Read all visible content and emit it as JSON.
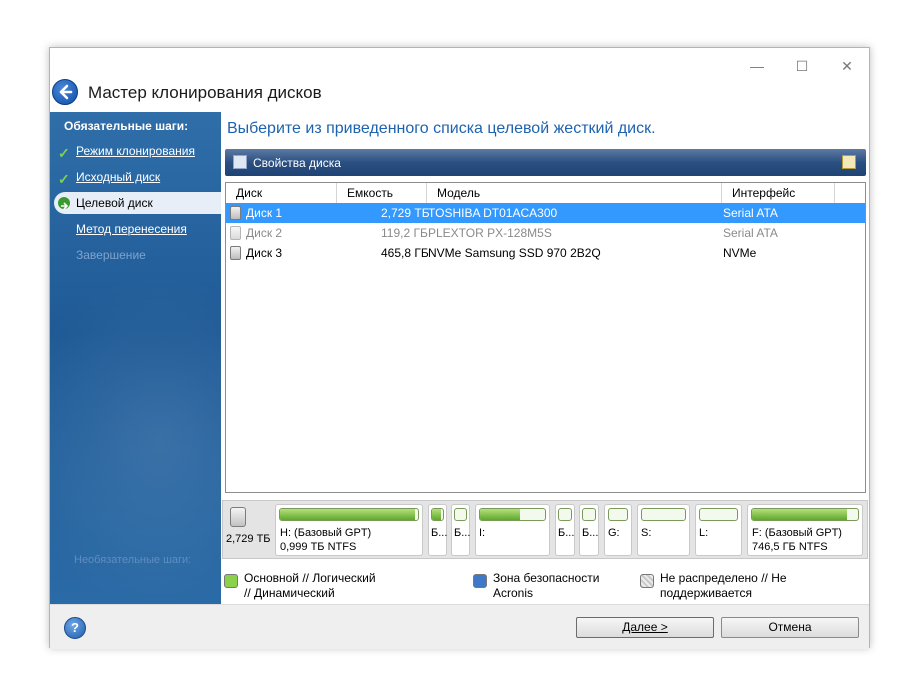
{
  "window": {
    "title": "Мастер клонирования дисков",
    "controls": {
      "minimize": "—",
      "maximize": "☐",
      "close": "✕"
    }
  },
  "sidebar": {
    "heading": "Обязательные шаги:",
    "items": [
      {
        "label": "Режим клонирования",
        "state": "done"
      },
      {
        "label": "Исходный диск",
        "state": "done"
      },
      {
        "label": "Целевой диск",
        "state": "current"
      },
      {
        "label": "Метод перенесения",
        "state": "link"
      },
      {
        "label": "Завершение",
        "state": "disabled"
      }
    ],
    "footer": "Необязательные шаги:"
  },
  "main": {
    "heading": "Выберите из приведенного списка целевой жесткий диск.",
    "props_bar": {
      "label": "Свойства диска"
    },
    "table": {
      "columns": [
        "Диск",
        "Емкость",
        "Модель",
        "Интерфейс"
      ],
      "rows": [
        {
          "disk": "Диск 1",
          "capacity": "2,729 ТБ",
          "model": "TOSHIBA DT01ACA300",
          "interface": "Serial ATA",
          "state": "selected"
        },
        {
          "disk": "Диск 2",
          "capacity": "119,2 ГБ",
          "model": "PLEXTOR PX-128M5S",
          "interface": "Serial ATA",
          "state": "disabled"
        },
        {
          "disk": "Диск 3",
          "capacity": "465,8 ГБ",
          "model": "NVMe Samsung SSD 970 2B2Q",
          "interface": "NVMe",
          "state": "normal"
        }
      ]
    },
    "disk_map": {
      "size": "2,729 ТБ",
      "partitions": [
        {
          "line1": "H: (Базовый GPT)",
          "line2": "0,999 ТБ  NTFS",
          "fill": 0.98
        },
        {
          "line1": "Б...",
          "line2": "",
          "fill": 0.8
        },
        {
          "line1": "Б...",
          "line2": "",
          "fill": 0.0
        },
        {
          "line1": "I:",
          "line2": "",
          "fill": 0.62
        },
        {
          "line1": "Б...",
          "line2": "",
          "fill": 0.0
        },
        {
          "line1": "Б...",
          "line2": "",
          "fill": 0.0
        },
        {
          "line1": "G:",
          "line2": "",
          "fill": 0.0
        },
        {
          "line1": "S:",
          "line2": "",
          "fill": 0.0
        },
        {
          "line1": "L:",
          "line2": "",
          "fill": 0.0
        },
        {
          "line1": "F: (Базовый GPT)",
          "line2": "746,5 ГБ  NTFS",
          "fill": 0.9
        }
      ]
    },
    "legend": [
      {
        "text": "Основной // Логический // Динамический",
        "color": "#8bd14b"
      },
      {
        "text": "Зона безопасности Acronis",
        "color": "#3e78c6"
      },
      {
        "text": "Не распределено // Не поддерживается",
        "color": "#c8c8c8"
      }
    ]
  },
  "footer": {
    "help": "?",
    "next_label": "Далее >",
    "cancel_label": "Отмена"
  },
  "colors": {
    "accent": "#1e63b0",
    "selection": "#3399ff",
    "sidebar": "#2a66a3"
  }
}
